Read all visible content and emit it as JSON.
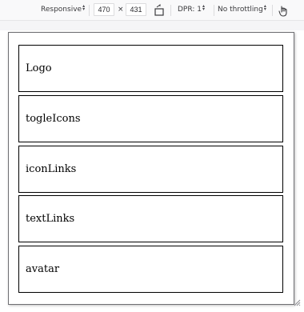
{
  "toolbar": {
    "device_select": "Responsive",
    "width_value": "470",
    "times_label": "×",
    "height_value": "431",
    "rotate_icon": "rotate-icon",
    "dpr_select": "DPR: 1",
    "throttling_select": "No throttling",
    "touch_icon": "touch-hand-icon"
  },
  "viewport": {
    "blocks": [
      {
        "label": "Logo"
      },
      {
        "label": "togleIcons"
      },
      {
        "label": "iconLinks"
      },
      {
        "label": "textLinks"
      },
      {
        "label": "avatar"
      }
    ]
  },
  "colors": {
    "toolbar_bg": "#f9f9fa",
    "viewport_border": "#6f6f73",
    "block_border": "#000000"
  }
}
